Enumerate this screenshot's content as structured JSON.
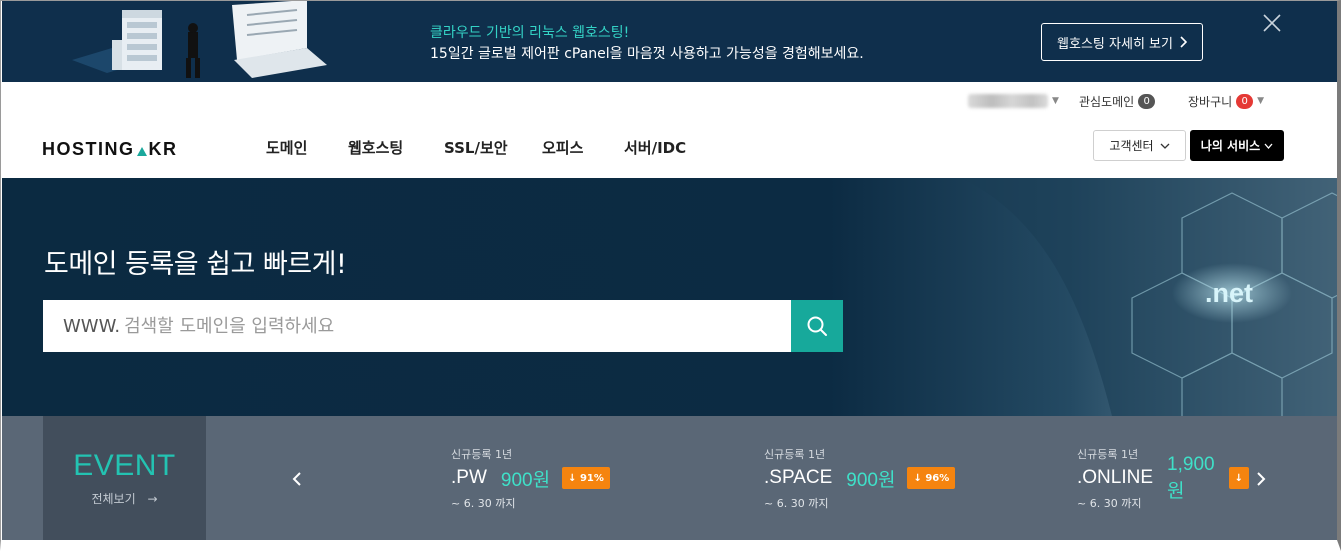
{
  "promo": {
    "line1": "클라우드 기반의 리눅스 웹호스팅!",
    "line2": "15일간 글로벌 제어판 cPanel을 마음껏 사용하고 가능성을 경험해보세요.",
    "cta": "웹호스팅 자세히 보기",
    "accent": "#34d3c6",
    "background": "#0f2f4c"
  },
  "header": {
    "util": {
      "watch_domain_label": "관심도메인",
      "watch_domain_count": "0",
      "cart_label": "장바구니",
      "cart_count": "0"
    },
    "logo": {
      "left": "HOSTING",
      "right": "KR"
    },
    "nav": [
      "도메인",
      "웹호스팅",
      "SSL/보안",
      "오피스",
      "서버/IDC"
    ],
    "customer_center": "고객센터",
    "my_service": "나의 서비스"
  },
  "hero": {
    "title": "도메인 등록을 쉽고 빠르게!",
    "search_prefix": "WWW.",
    "search_placeholder": "검색할 도메인을 입력하세요",
    "tld_graphic": ".net",
    "accent": "#17a99b"
  },
  "events": {
    "title": "EVENT",
    "view_all": "전체보기",
    "deals": [
      {
        "label": "신규등록 1년",
        "tld": ".PW",
        "price": "900원",
        "discount": "↓ 91%",
        "until": "~ 6. 30 까지"
      },
      {
        "label": "신규등록 1년",
        "tld": ".SPACE",
        "price": "900원",
        "discount": "↓ 96%",
        "until": "~ 6. 30 까지"
      },
      {
        "label": "신규등록 1년",
        "tld": ".ONLINE",
        "price": "1,900원",
        "discount": "↓",
        "until": "~ 6. 30 까지"
      }
    ],
    "discount_color": "#f5840f",
    "price_color": "#3fe0c8"
  }
}
